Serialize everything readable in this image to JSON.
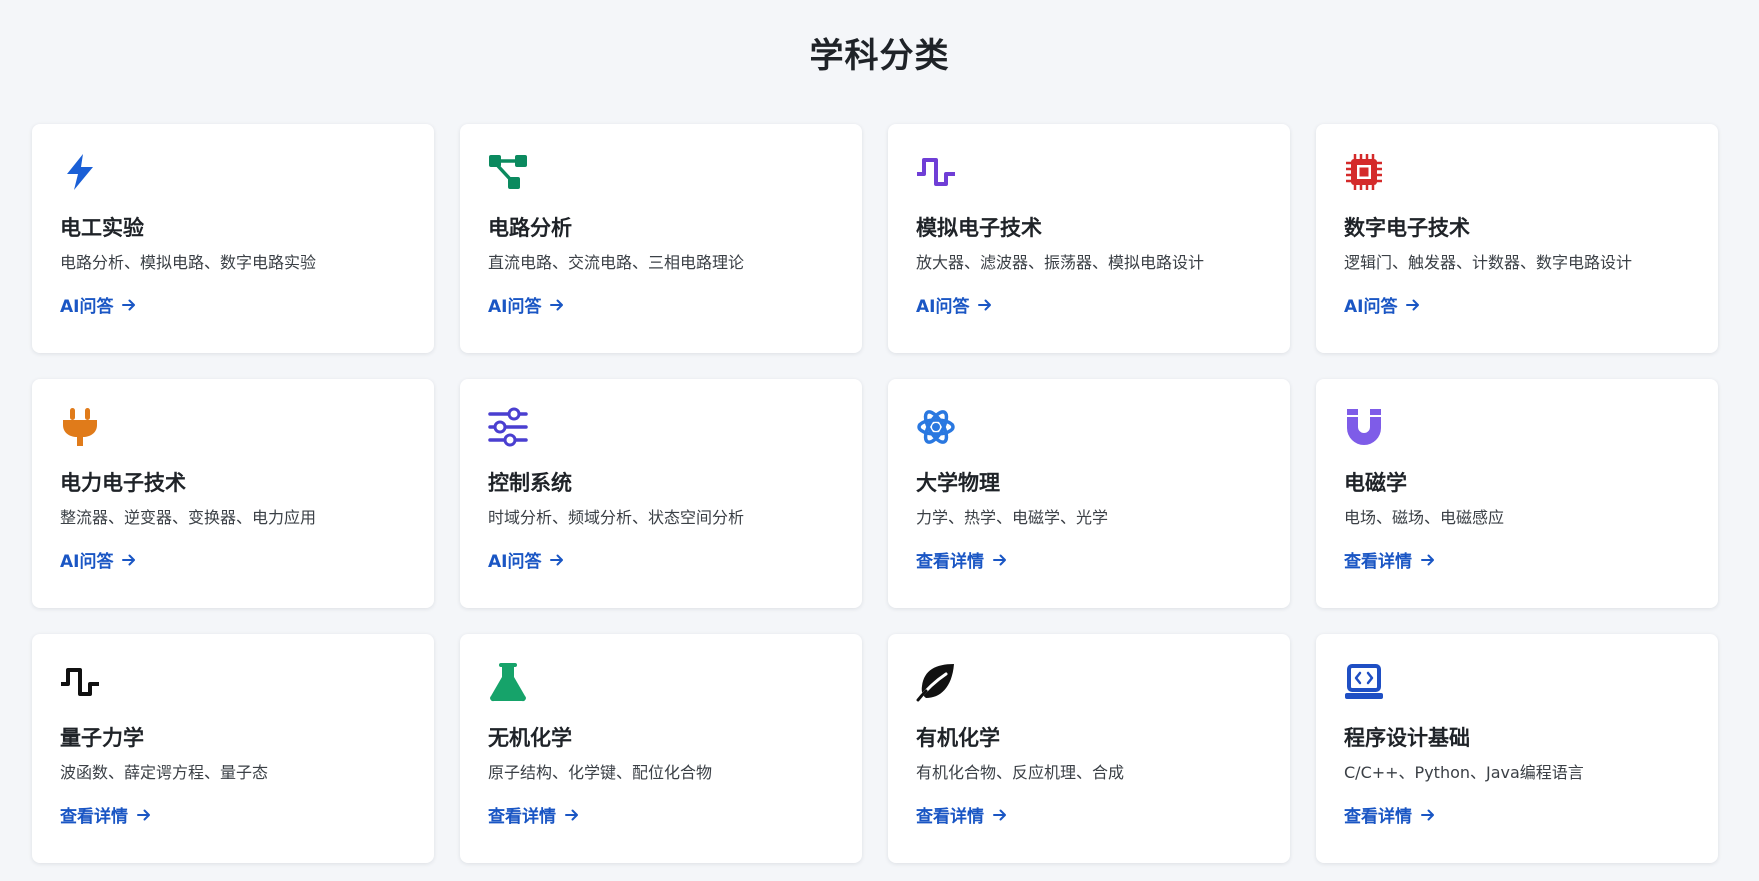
{
  "page": {
    "title": "学科分类"
  },
  "colors": {
    "accent": "#1a56c4",
    "lightning": "#1a5fd6",
    "circuit": "#0b8a5f",
    "analog": "#6f3ed6",
    "chip": "#d42a2a",
    "plug": "#e07b1a",
    "sliders": "#4a3fd0",
    "atom": "#2a78e0",
    "magnet": "#7e5ce8",
    "quantum": "#111111",
    "flask": "#16a36a",
    "leaf": "#111111",
    "laptop": "#1f4fc4"
  },
  "cards": [
    {
      "icon": "lightning-icon",
      "title": "电工实验",
      "desc": "电路分析、模拟电路、数字电路实验",
      "link": "AI问答"
    },
    {
      "icon": "circuit-icon",
      "title": "电路分析",
      "desc": "直流电路、交流电路、三相电路理论",
      "link": "AI问答"
    },
    {
      "icon": "analog-wave-icon",
      "title": "模拟电子技术",
      "desc": "放大器、滤波器、振荡器、模拟电路设计",
      "link": "AI问答"
    },
    {
      "icon": "chip-icon",
      "title": "数字电子技术",
      "desc": "逻辑门、触发器、计数器、数字电路设计",
      "link": "AI问答"
    },
    {
      "icon": "plug-icon",
      "title": "电力电子技术",
      "desc": "整流器、逆变器、变换器、电力应用",
      "link": "AI问答"
    },
    {
      "icon": "sliders-icon",
      "title": "控制系统",
      "desc": "时域分析、频域分析、状态空间分析",
      "link": "AI问答"
    },
    {
      "icon": "atom-icon",
      "title": "大学物理",
      "desc": "力学、热学、电磁学、光学",
      "link": "查看详情"
    },
    {
      "icon": "magnet-icon",
      "title": "电磁学",
      "desc": "电场、磁场、电磁感应",
      "link": "查看详情"
    },
    {
      "icon": "quantum-wave-icon",
      "title": "量子力学",
      "desc": "波函数、薛定谔方程、量子态",
      "link": "查看详情"
    },
    {
      "icon": "flask-icon",
      "title": "无机化学",
      "desc": "原子结构、化学键、配位化合物",
      "link": "查看详情"
    },
    {
      "icon": "leaf-icon",
      "title": "有机化学",
      "desc": "有机化合物、反应机理、合成",
      "link": "查看详情"
    },
    {
      "icon": "laptop-code-icon",
      "title": "程序设计基础",
      "desc": "C/C++、Python、Java编程语言",
      "link": "查看详情"
    }
  ]
}
